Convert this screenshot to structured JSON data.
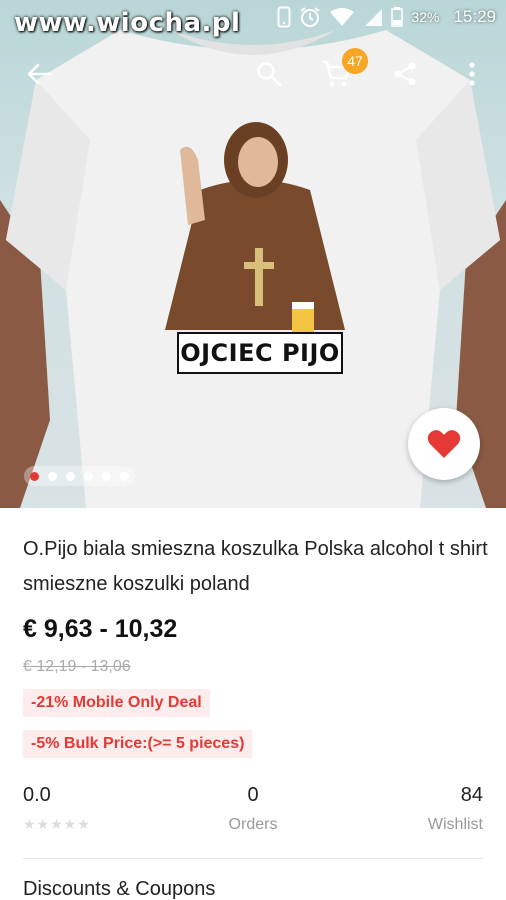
{
  "status_bar": {
    "watermark": "www.wiocha.pl",
    "battery_percent": "32%",
    "time": "15:29"
  },
  "toolbar": {
    "back_icon": "arrow-back-icon",
    "search_icon": "search-icon",
    "cart_icon": "cart-icon",
    "cart_count": "47",
    "share_icon": "share-icon",
    "more_icon": "more-vert-icon"
  },
  "gallery": {
    "print_text": "OJCIEC PIJO",
    "dot_count": 6,
    "active_index": 0
  },
  "favorite_icon": "heart-icon",
  "product": {
    "title": "O.Pijo biala smieszna koszulka Polska alcohol t shirt smieszne koszulki poland",
    "price": "€ 9,63 - 10,32",
    "original_price": "€ 12,19 - 13,06",
    "deal_mobile": "-21% Mobile Only Deal",
    "deal_bulk": "-5% Bulk Price:(>= 5 pieces)"
  },
  "stats": {
    "rating": "0.0",
    "stars": "★★★★★",
    "orders_count": "0",
    "orders_label": "Orders",
    "wishlist_count": "84",
    "wishlist_label": "Wishlist"
  },
  "sections": {
    "discounts_title": "Discounts & Coupons"
  },
  "colors": {
    "accent_red": "#e53935",
    "badge_orange": "#f6a623"
  }
}
